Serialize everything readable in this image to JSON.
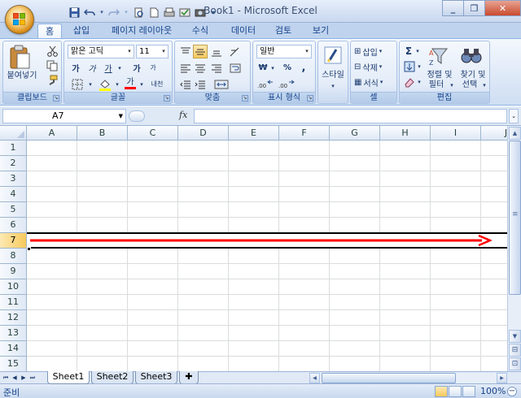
{
  "window": {
    "doc": "Book1",
    "sep": " - ",
    "app": "Microsoft Excel"
  },
  "ribbon_tabs": [
    "홈",
    "삽입",
    "페이지 레이아웃",
    "수식",
    "데이터",
    "검토",
    "보기"
  ],
  "clipboard": {
    "paste": "붙여넣기",
    "label": "클립보드"
  },
  "font": {
    "name": "맑은 고딕",
    "size": "11",
    "label": "글꼴",
    "bold": "가",
    "italic": "가",
    "underline": "가",
    "grow": "가",
    "shrink": "가",
    "color_a": "가",
    "phonetic": "내천"
  },
  "alignment": {
    "label": "맞춤"
  },
  "number": {
    "format": "일반",
    "label": "표시 형식",
    "currency": "₩",
    "percent": "%",
    "comma": ","
  },
  "styles": {
    "label": "스타일"
  },
  "cells": {
    "insert": "삽입",
    "delete": "삭제",
    "format": "서식",
    "label": "셀"
  },
  "editing": {
    "sort": "정렬 및",
    "sort2": "필터",
    "find": "찾기 및",
    "find2": "선택",
    "label": "편집",
    "sigma": "Σ"
  },
  "namebox": "A7",
  "fx": "fx",
  "columns": [
    "A",
    "B",
    "C",
    "D",
    "E",
    "F",
    "G",
    "H",
    "I",
    "J"
  ],
  "rows": [
    "1",
    "2",
    "3",
    "4",
    "5",
    "6",
    "7",
    "8",
    "9",
    "10",
    "11",
    "12",
    "13",
    "14",
    "15"
  ],
  "selected_row": "7",
  "sheets": [
    "Sheet1",
    "Sheet2",
    "Sheet3"
  ],
  "status": "준비",
  "zoom": "100%",
  "colors": {
    "arrow": "#ff0000",
    "accent": "#15428b"
  }
}
